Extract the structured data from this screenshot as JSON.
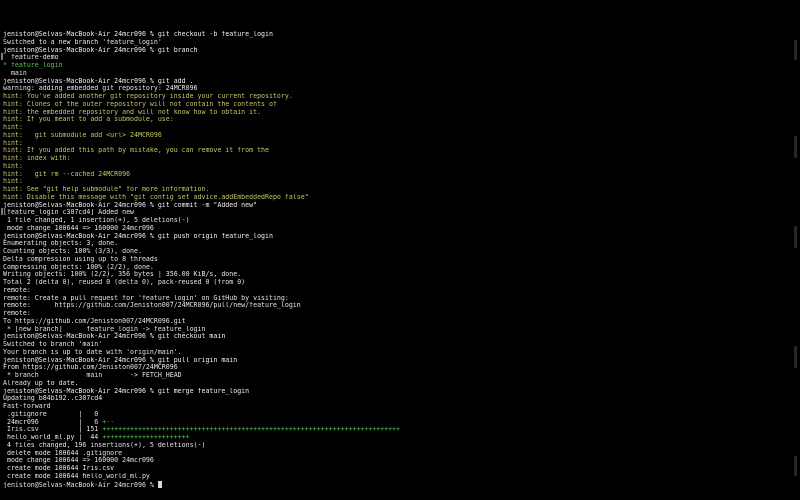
{
  "terminal": {
    "prompt": "jeniston@Selvas-MacBook-Air 24mcr096 % ",
    "lines": [
      {
        "text": "jeniston@Selvas-MacBook-Air 24mcr096 % git checkout -b feature_login",
        "kind": "cmd"
      },
      {
        "text": "Switched to a new branch 'feature_login'",
        "kind": "out"
      },
      {
        "text": "jeniston@Selvas-MacBook-Air 24mcr096 % git branch",
        "kind": "cmd"
      },
      {
        "text": "  feature-demo",
        "kind": "out"
      },
      {
        "text": "* feature_login",
        "kind": "green"
      },
      {
        "text": "  main",
        "kind": "out"
      },
      {
        "text": "jeniston@Selvas-MacBook-Air 24mcr096 % git add .",
        "kind": "cmd"
      },
      {
        "text": "warning: adding embedded git repository: 24MCR096",
        "kind": "out"
      },
      {
        "text": "hint: You've added another git repository inside your current repository.",
        "kind": "hint"
      },
      {
        "text": "hint: Clones of the outer repository will not contain the contents of",
        "kind": "hint"
      },
      {
        "text": "hint: the embedded repository and will not know how to obtain it.",
        "kind": "hint"
      },
      {
        "text": "hint: If you meant to add a submodule, use:",
        "kind": "hint"
      },
      {
        "text": "hint:",
        "kind": "hint"
      },
      {
        "text": "hint:   git submodule add <url> 24MCR096",
        "kind": "hint"
      },
      {
        "text": "hint:",
        "kind": "hint"
      },
      {
        "text": "hint: If you added this path by mistake, you can remove it from the",
        "kind": "hint"
      },
      {
        "text": "hint: index with:",
        "kind": "hint"
      },
      {
        "text": "hint:",
        "kind": "hint"
      },
      {
        "text": "hint:   git rm --cached 24MCR096",
        "kind": "hint"
      },
      {
        "text": "hint:",
        "kind": "hint"
      },
      {
        "text": "hint: See \"git help submodule\" for more information.",
        "kind": "hint"
      },
      {
        "text": "hint: Disable this message with \"git config set advice.addEmbeddedRepo false\"",
        "kind": "hint"
      },
      {
        "text": "jeniston@Selvas-MacBook-Air 24mcr096 % git commit -m \"Added new\"",
        "kind": "cmd"
      },
      {
        "text": "[feature_login c307cd4] Added new",
        "kind": "out"
      },
      {
        "text": " 1 file changed, 1 insertion(+), 5 deletions(-)",
        "kind": "out"
      },
      {
        "text": " mode change 100644 => 160000 24mcr096",
        "kind": "out"
      },
      {
        "text": "jeniston@Selvas-MacBook-Air 24mcr096 % git push origin feature_login",
        "kind": "cmd"
      },
      {
        "text": "Enumerating objects: 3, done.",
        "kind": "out"
      },
      {
        "text": "Counting objects: 100% (3/3), done.",
        "kind": "out"
      },
      {
        "text": "Delta compression using up to 8 threads",
        "kind": "out"
      },
      {
        "text": "Compressing objects: 100% (2/2), done.",
        "kind": "out"
      },
      {
        "text": "Writing objects: 100% (2/2), 356 bytes | 356.00 KiB/s, done.",
        "kind": "out"
      },
      {
        "text": "Total 2 (delta 0), reused 0 (delta 0), pack-reused 0 (from 0)",
        "kind": "out"
      },
      {
        "text": "remote:",
        "kind": "out"
      },
      {
        "text": "remote: Create a pull request for 'feature_login' on GitHub by visiting:",
        "kind": "out"
      },
      {
        "text": "remote:      https://github.com/Jeniston007/24MCR096/pull/new/feature_login",
        "kind": "out"
      },
      {
        "text": "remote:",
        "kind": "out"
      },
      {
        "text": "To https://github.com/Jeniston007/24MCR096.git",
        "kind": "out"
      },
      {
        "text": " * [new branch]      feature_login -> feature_login",
        "kind": "out"
      },
      {
        "text": "jeniston@Selvas-MacBook-Air 24mcr096 % git checkout main",
        "kind": "cmd"
      },
      {
        "text": "Switched to branch 'main'",
        "kind": "out"
      },
      {
        "text": "Your branch is up to date with 'origin/main'.",
        "kind": "out"
      },
      {
        "text": "jeniston@Selvas-MacBook-Air 24mcr096 % git pull origin main",
        "kind": "cmd"
      },
      {
        "text": "From https://github.com/Jeniston007/24MCR096",
        "kind": "out"
      },
      {
        "text": " * branch            main       -> FETCH_HEAD",
        "kind": "out"
      },
      {
        "text": "Already up to date.",
        "kind": "out"
      },
      {
        "text": "jeniston@Selvas-MacBook-Air 24mcr096 % git merge feature_login",
        "kind": "cmd"
      },
      {
        "text": "Updating b84b192..c307cd4",
        "kind": "out"
      },
      {
        "text": "Fast-forward",
        "kind": "out"
      },
      {
        "text": " .gitignore        |   0",
        "kind": "out"
      },
      {
        "text": " 24mcr096          |   6 +--",
        "kind": "stat",
        "prefix": " 24mcr096          |   6 ",
        "plus": "+",
        "minus": "--"
      },
      {
        "text": " Iris.csv          | 151 +++++++++++++++++++++++++++++++++++++++++++++++++++++++++++++++++++++++++++",
        "kind": "stat",
        "prefix": " Iris.csv          | 151 ",
        "plus": "+++++++++++++++++++++++++++++++++++++++++++++++++++++++++++++++++++++++++++",
        "minus": ""
      },
      {
        "text": " hello_world_ml.py |  44 ++++++++++++++++++++++",
        "kind": "stat",
        "prefix": " hello_world_ml.py |  44 ",
        "plus": "++++++++++++++++++++++",
        "minus": ""
      },
      {
        "text": " 4 files changed, 196 insertions(+), 5 deletions(-)",
        "kind": "out"
      },
      {
        "text": " delete mode 100644 .gitignore",
        "kind": "out"
      },
      {
        "text": " mode change 100644 => 160000 24mcr096",
        "kind": "out"
      },
      {
        "text": " create mode 100644 Iris.csv",
        "kind": "out"
      },
      {
        "text": " create mode 100644 hello_world_ml.py",
        "kind": "out"
      },
      {
        "text": "jeniston@Selvas-MacBook-Air 24mcr096 % ",
        "kind": "prompt"
      }
    ]
  },
  "colors": {
    "background": "#000000",
    "text": "#e6e6e6",
    "hint": "#c4c46a",
    "branch_current": "#52c452",
    "diff_plus": "#52c452",
    "diff_minus": "#d05050"
  }
}
